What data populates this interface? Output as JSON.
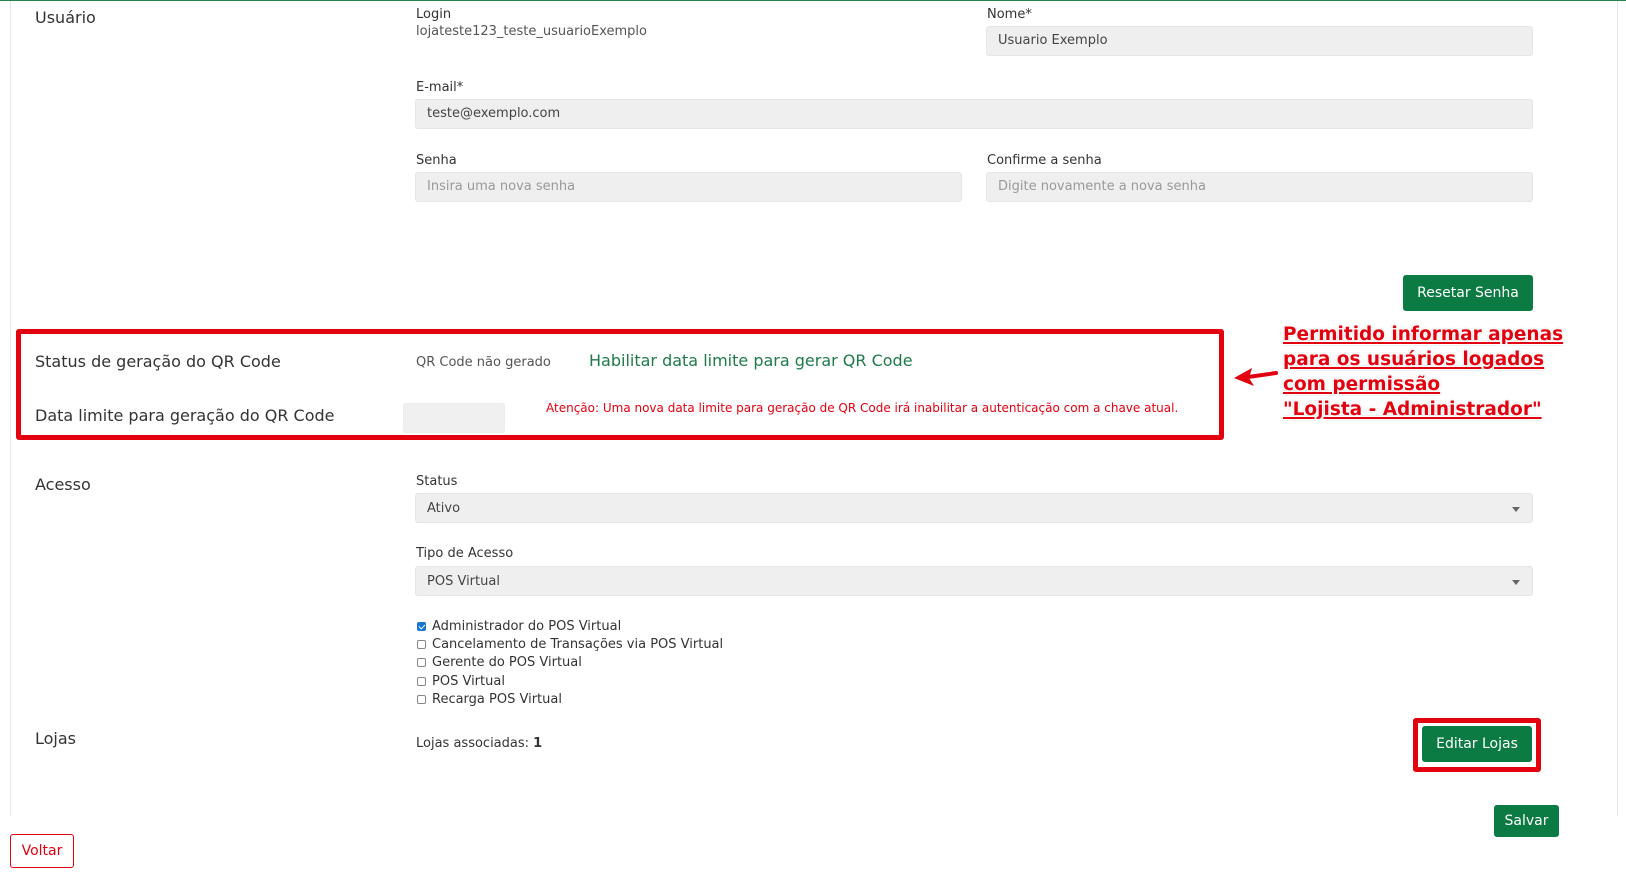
{
  "user": {
    "section_title": "Usuário",
    "login_label": "Login",
    "login_value": "lojateste123_teste_usuarioExemplo",
    "name_label": "Nome*",
    "name_value": "Usuario Exemplo",
    "email_label": "E-mail*",
    "email_value": "teste@exemplo.com",
    "password_label": "Senha",
    "password_placeholder": "Insira uma nova senha",
    "confirm_label": "Confirme a senha",
    "confirm_placeholder": "Digite novamente a nova senha",
    "reset_button": "Resetar Senha"
  },
  "qrcode": {
    "status_title": "Status de geração do QR Code",
    "status_value": "QR Code não gerado",
    "enable_link": "Habilitar data limite para gerar QR Code",
    "deadline_title": "Data limite para geração do QR Code",
    "warning": "Atenção: Uma nova data limite para geração de QR Code irá inabilitar a autenticação com a chave atual."
  },
  "annotation": {
    "lines": [
      "Permitido informar apenas",
      "para os usuários logados",
      "com permissão",
      "\"Lojista - Administrador\""
    ]
  },
  "access": {
    "section_title": "Acesso",
    "status_label": "Status",
    "status_value": "Ativo",
    "type_label": "Tipo de Acesso",
    "type_value": "POS Virtual",
    "permissions": [
      {
        "label": "Administrador do POS Virtual",
        "checked": true
      },
      {
        "label": "Cancelamento de Transações via POS Virtual",
        "checked": false
      },
      {
        "label": "Gerente do POS Virtual",
        "checked": false
      },
      {
        "label": "POS Virtual",
        "checked": false
      },
      {
        "label": "Recarga POS Virtual",
        "checked": false
      }
    ]
  },
  "stores": {
    "section_title": "Lojas",
    "associated_label": "Lojas associadas:",
    "associated_count": "1",
    "edit_button": "Editar Lojas"
  },
  "footer": {
    "back_button": "Voltar",
    "save_button": "Salvar"
  },
  "colors": {
    "accent_green": "#0b7a43",
    "highlight_red": "#e3000f"
  }
}
